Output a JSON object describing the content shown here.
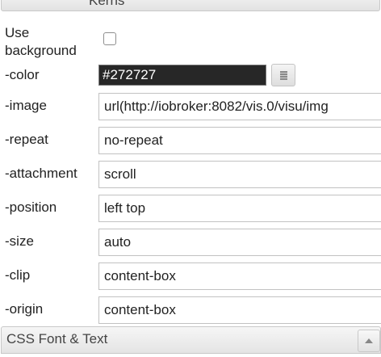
{
  "sections": {
    "previous_title": "Kerns",
    "next_title": "CSS Font & Text"
  },
  "fields": {
    "use_background": {
      "label_line1": "Use",
      "label_line2": "background",
      "checked": false
    },
    "color": {
      "label": "-color",
      "value": "#272727",
      "swatch": "#272727"
    },
    "image": {
      "label": "-image",
      "value": "url(http://iobroker:8082/vis.0/visu/img"
    },
    "repeat": {
      "label": "-repeat",
      "value": "no-repeat"
    },
    "attachment": {
      "label": "-attachment",
      "value": "scroll"
    },
    "position": {
      "label": "-position",
      "value": "left top"
    },
    "size": {
      "label": "-size",
      "value": "auto"
    },
    "clip": {
      "label": "-clip",
      "value": "content-box"
    },
    "origin": {
      "label": "-origin",
      "value": "content-box"
    }
  },
  "icons": {
    "color_picker": "color-picker-icon",
    "collapse": "triangle-up-icon"
  }
}
